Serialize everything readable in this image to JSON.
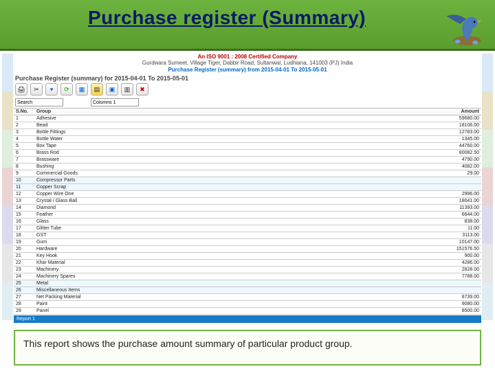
{
  "slide": {
    "title": "Purchase register (Summary)",
    "caption": "This report shows the purchase amount summary of particular product group."
  },
  "report": {
    "cert_line": "An ISO 9001 : 2008 Certified Company",
    "address": "Gurdwara Sumeet, Village Tiger, Dabbir Road, Sultanwal, Ludhiana, 141003 (PJ) India",
    "range_line": "Purchase Register (summary) from 2015-04-01 To 2015-05-01",
    "heading": "Purchase Register (summary) for 2015-04-01 To 2015-05-01",
    "filter_labels": {
      "search": "Search",
      "columns": "Columns 1"
    },
    "columns": {
      "sn": "S.No.",
      "group": "Group",
      "amount": "Amount"
    },
    "rows": [
      {
        "sn": "1",
        "group": "Adhesive",
        "amount": "59680.00"
      },
      {
        "sn": "2",
        "group": "Bead",
        "amount": "18106.00"
      },
      {
        "sn": "3",
        "group": "Bottle Fittings",
        "amount": "12783.00"
      },
      {
        "sn": "4",
        "group": "Bottle Water",
        "amount": "1345.00"
      },
      {
        "sn": "5",
        "group": "Box Tape",
        "amount": "44760.00"
      },
      {
        "sn": "6",
        "group": "Brass Rod",
        "amount": "80082.50"
      },
      {
        "sn": "7",
        "group": "Brassware",
        "amount": "4790.00"
      },
      {
        "sn": "8",
        "group": "Bushing",
        "amount": "4082.00"
      },
      {
        "sn": "9",
        "group": "Commercial Goods",
        "amount": "29.00"
      },
      {
        "sn": "10",
        "group": "Compressor Parts",
        "amount": ""
      },
      {
        "sn": "11",
        "group": "Copper Scrap",
        "amount": ""
      },
      {
        "sn": "12",
        "group": "Copper Wire One",
        "amount": "2996.00"
      },
      {
        "sn": "13",
        "group": "Crystal / Glass Ball",
        "amount": "18041.00"
      },
      {
        "sn": "14",
        "group": "Diamond",
        "amount": "11393.00"
      },
      {
        "sn": "15",
        "group": "Feather",
        "amount": "6644.00"
      },
      {
        "sn": "16",
        "group": "Glass",
        "amount": "838.00"
      },
      {
        "sn": "17",
        "group": "Glitter Tube",
        "amount": "11.00"
      },
      {
        "sn": "18",
        "group": "GST",
        "amount": "3113.00"
      },
      {
        "sn": "19",
        "group": "Gum",
        "amount": "10147.00"
      },
      {
        "sn": "20",
        "group": "Hardware",
        "amount": "151576.50"
      },
      {
        "sn": "21",
        "group": "Key Hook",
        "amount": "900.00"
      },
      {
        "sn": "22",
        "group": "Khar Material",
        "amount": "4286.00"
      },
      {
        "sn": "23",
        "group": "Machinery",
        "amount": "2828.00"
      },
      {
        "sn": "24",
        "group": "Machinery Spares",
        "amount": "7788.00"
      },
      {
        "sn": "25",
        "group": "Metal",
        "amount": ""
      },
      {
        "sn": "26",
        "group": "Miscellaneous Items",
        "amount": ""
      },
      {
        "sn": "27",
        "group": "Net Packing Material",
        "amount": "8739.00"
      },
      {
        "sn": "28",
        "group": "Paint",
        "amount": "9080.00"
      },
      {
        "sn": "29",
        "group": "Panel",
        "amount": "8500.00"
      }
    ],
    "footer": "Report 1"
  }
}
